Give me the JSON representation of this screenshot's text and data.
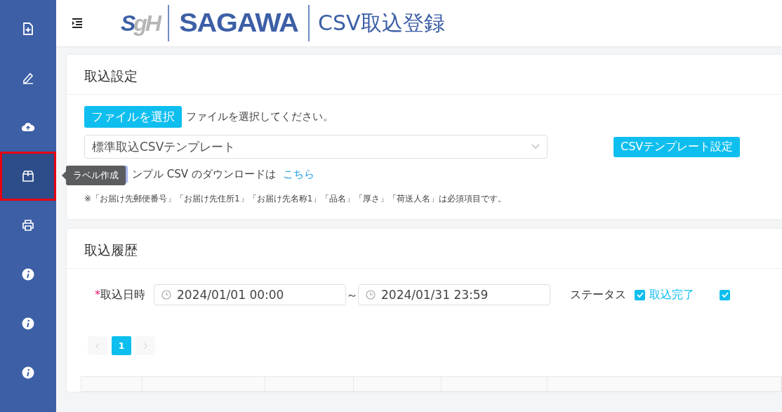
{
  "sidebar": {
    "items": [
      {
        "kind": "file-plus",
        "selected": false
      },
      {
        "kind": "pen",
        "selected": false
      },
      {
        "kind": "cloud",
        "selected": false
      },
      {
        "kind": "box",
        "selected": true,
        "highlighted": true,
        "tooltip": "ラベル作成"
      },
      {
        "kind": "printer",
        "selected": false
      },
      {
        "kind": "info",
        "selected": false
      },
      {
        "kind": "info",
        "selected": false
      },
      {
        "kind": "info",
        "selected": false
      }
    ]
  },
  "header": {
    "logo_mark": "SgH",
    "wordmark": "SAGAWA",
    "title": "CSV取込登録"
  },
  "import_settings": {
    "title": "取込設定",
    "file_button": "ファイルを選択",
    "file_status": "ファイルを選択してください。",
    "template_select": "標準取込CSVテンプレート",
    "template_button": "CSVテンプレート設定",
    "sample_text": "ンプル CSV のダウンロードは",
    "sample_link": "こちら",
    "note": "※「お届け先郵便番号」「お届け先住所1」「お届け先名称1」「品名」「厚さ」「荷送人名」は必須項目です。"
  },
  "history": {
    "title": "取込履歴",
    "date_label": "取込日時",
    "required_mark": "*",
    "date_from": "2024/01/01 00:00",
    "range_sep": "～",
    "date_to": "2024/01/31 23:59",
    "status_label": "ステータス",
    "statuses": [
      {
        "label": "取込完了",
        "checked": true
      },
      {
        "checked": true
      }
    ],
    "pagination": {
      "pages": [
        {
          "label": "1",
          "selected": true
        }
      ],
      "prev_disabled": true,
      "next_disabled": true
    }
  }
}
